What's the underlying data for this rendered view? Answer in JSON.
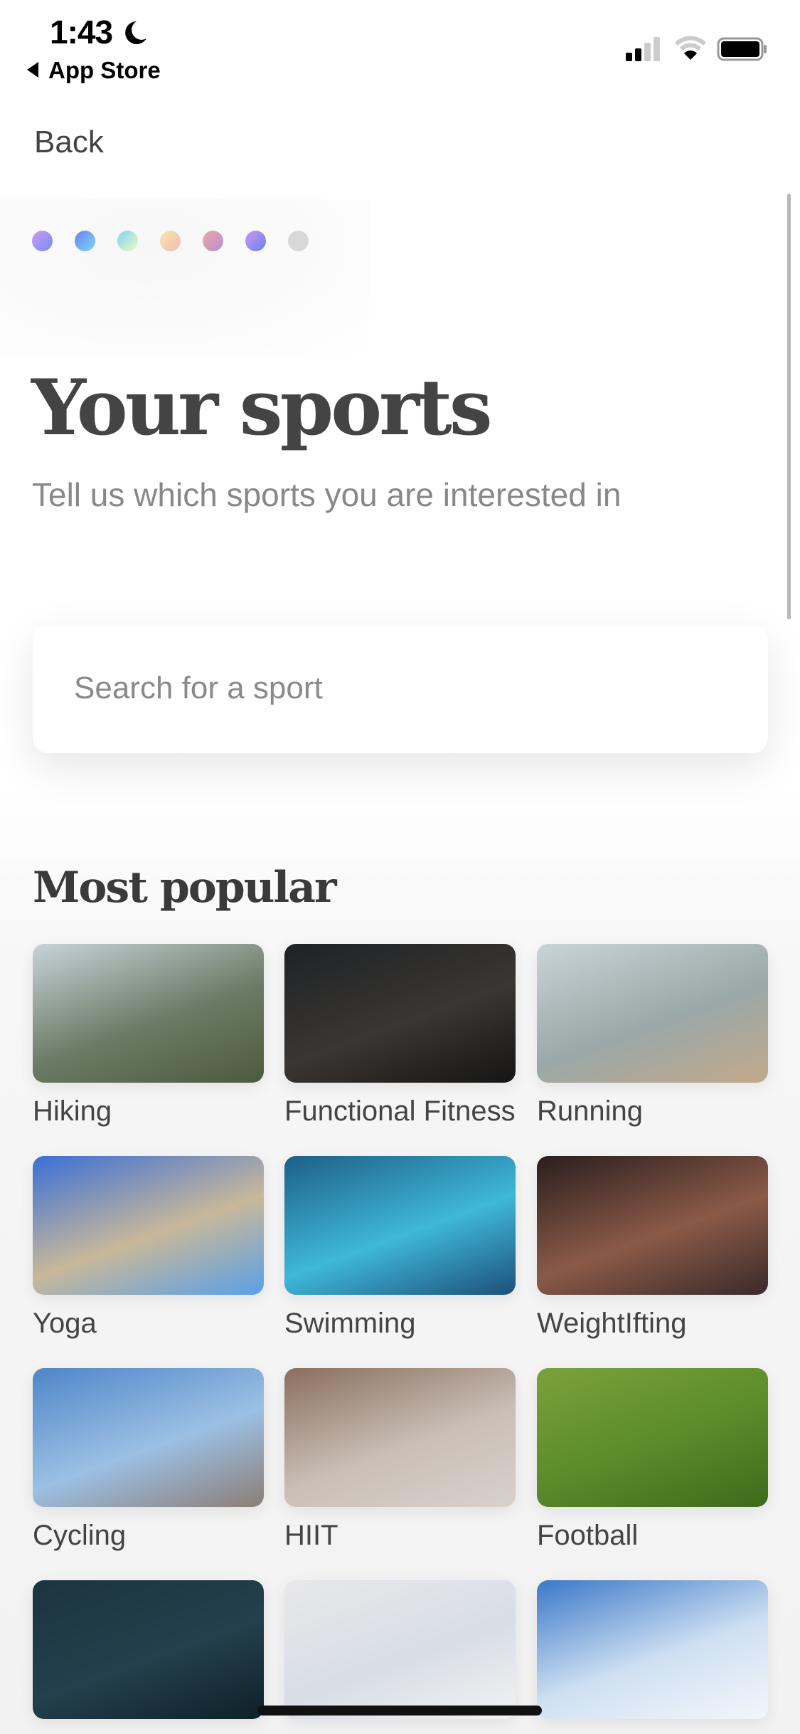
{
  "status_bar": {
    "time": "1:43",
    "back_app": "App Store",
    "moon_icon": "moon-icon",
    "signal_icon": "cellular-signal-icon",
    "wifi_icon": "wifi-icon",
    "battery_icon": "battery-icon"
  },
  "nav": {
    "back_label": "Back"
  },
  "progress": {
    "total_steps": 7,
    "completed_steps": 6,
    "dot_colors": [
      [
        "#c79cf2",
        "#7a8cf0"
      ],
      [
        "#6a7ff2",
        "#7fd8f5"
      ],
      [
        "#7fd3f5",
        "#eefac0"
      ],
      [
        "#f7e9a8",
        "#f2b8b8"
      ],
      [
        "#f0a8a0",
        "#b58ed8"
      ],
      [
        "#c89cf2",
        "#6a7ff2"
      ],
      [
        "#d8d8d8",
        "#d8d8d8"
      ]
    ]
  },
  "header": {
    "title": "Your sports",
    "subtitle": "Tell us which sports you are interested in"
  },
  "search": {
    "placeholder": "Search for a sport"
  },
  "section_title": "Most popular",
  "sports": [
    {
      "label": "Hiking",
      "colors": [
        "#c9d3da",
        "#6c7b66",
        "#4d5a3f"
      ]
    },
    {
      "label": "Functional Fitness",
      "colors": [
        "#1e2226",
        "#3a3632",
        "#151515"
      ]
    },
    {
      "label": "Running",
      "colors": [
        "#c9d4d6",
        "#9aa8a8",
        "#c2a98a"
      ]
    },
    {
      "label": "Yoga",
      "colors": [
        "#3a6fd6",
        "#c8b89a",
        "#5aa0e6"
      ]
    },
    {
      "label": "Swimming",
      "colors": [
        "#1d5f86",
        "#3fb8d8",
        "#1d4f7a"
      ]
    },
    {
      "label": "WeightIfting",
      "colors": [
        "#2a1e1e",
        "#8a5a48",
        "#3a2a2a"
      ]
    },
    {
      "label": "Cycling",
      "colors": [
        "#4f86c8",
        "#9cc0e4",
        "#8c7e76"
      ]
    },
    {
      "label": "HIIT",
      "colors": [
        "#8a6e5e",
        "#c9bfb6",
        "#d8d2cc"
      ]
    },
    {
      "label": "Football",
      "colors": [
        "#7aa23a",
        "#5a8a2a",
        "#3e6a1c"
      ]
    },
    {
      "label": "",
      "colors": [
        "#1b3540",
        "#23404c",
        "#0f2028"
      ]
    },
    {
      "label": "",
      "colors": [
        "#e8e8ea",
        "#d8dde6",
        "#f2f2f2"
      ]
    },
    {
      "label": "",
      "colors": [
        "#3a78c8",
        "#cfe0f2",
        "#f4f6fa"
      ]
    }
  ]
}
